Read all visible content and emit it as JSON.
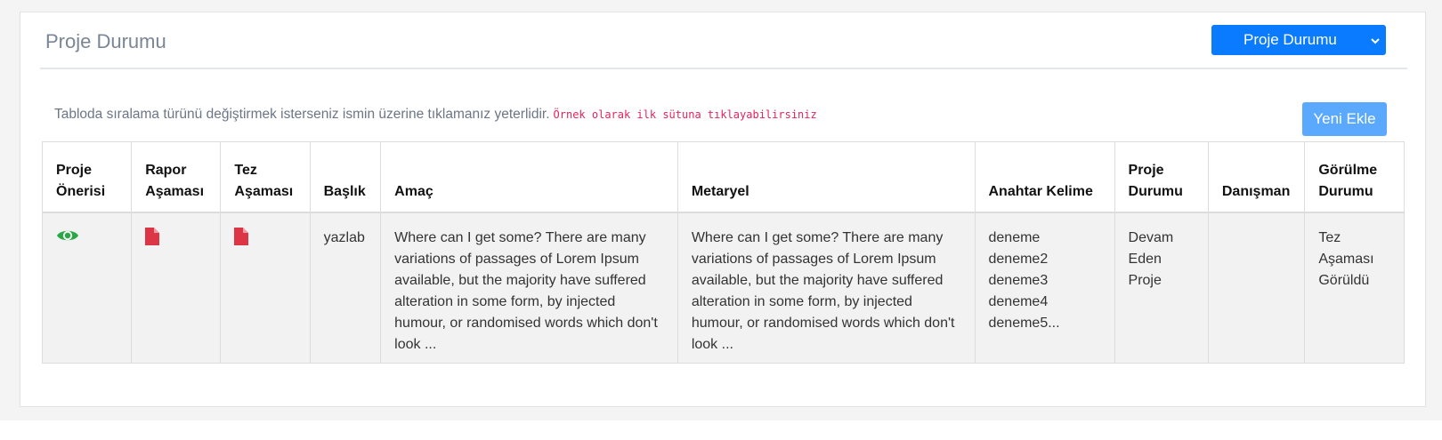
{
  "header": {
    "title": "Proje Durumu",
    "dropdown_label": "Proje Durumu"
  },
  "hint": {
    "text": "Tabloda sıralama türünü değiştirmek isterseniz ismin üzerine tıklamanız yeterlidir.",
    "code": "Örnek olarak ilk sütuna tıklayabilirsiniz"
  },
  "new_button_label": "Yeni Ekle",
  "table": {
    "columns": [
      [
        "Proje",
        "Önerisi"
      ],
      [
        "Rapor",
        "Aşaması"
      ],
      [
        "Tez",
        "Aşaması"
      ],
      [
        "Başlık"
      ],
      [
        "Amaç"
      ],
      [
        "Metaryel"
      ],
      [
        "Anahtar Kelime"
      ],
      [
        "Proje",
        "Durumu"
      ],
      [
        "Danışman"
      ],
      [
        "Görülme",
        "Durumu"
      ]
    ],
    "rows": [
      {
        "proposal_icon": "eye-icon",
        "report_icon": "file-icon",
        "thesis_icon": "file-icon",
        "title": "yazlab",
        "aim": "Where can I get some? There are many variations of passages of Lorem Ipsum available, but the majority have suffered alteration in some form, by injected humour, or randomised words which don't look ...",
        "material": "Where can I get some? There are many variations of passages of Lorem Ipsum available, but the majority have suffered alteration in some form, by injected humour, or randomised words which don't look ...",
        "keywords": [
          "deneme",
          "deneme2",
          "deneme3",
          "deneme4",
          "deneme5..."
        ],
        "status": [
          "Devam",
          "Eden",
          "Proje"
        ],
        "advisor": "",
        "seen_status": [
          "Tez",
          "Aşaması",
          "Görüldü"
        ]
      }
    ]
  },
  "colors": {
    "primary": "#0a7bff",
    "primary_light": "#5aa9ff",
    "eye_icon": "#28a745",
    "file_icon": "#dc3545",
    "hint_code": "#e0245e"
  }
}
